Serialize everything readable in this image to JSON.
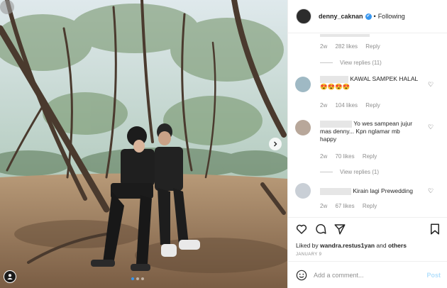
{
  "header": {
    "username": "denny_caknan",
    "verified_mark": "✔",
    "separator": "•",
    "follow_status": "Following",
    "more_icon": "more-horizontal-icon"
  },
  "comments": [
    {
      "text": "",
      "time": "2w",
      "likes": "282 likes",
      "reply": "Reply",
      "view_replies": "View replies (11)"
    },
    {
      "text": "KAWAL SAMPEK HALAL",
      "emoji": "😍😍😍😍",
      "time": "2w",
      "likes": "104 likes",
      "reply": "Reply"
    },
    {
      "text_line1": "Yo wes sampean jujur",
      "text_line2": "mas denny... Kpn nglamar mb",
      "text_line3": "happy",
      "time": "2w",
      "likes": "70 likes",
      "reply": "Reply",
      "view_replies": "View replies (1)"
    },
    {
      "text": "Kirain lagi Prewedding",
      "time": "2w",
      "likes": "67 likes",
      "reply": "Reply"
    }
  ],
  "actions": {
    "icons": [
      "heart-icon",
      "comment-icon",
      "share-icon",
      "bookmark-icon"
    ],
    "liked_by_prefix": "Liked by ",
    "liked_by_user": "wandra.restus1yan",
    "liked_by_and": " and ",
    "liked_by_others": "others",
    "date": "JANUARY 9"
  },
  "add_comment": {
    "placeholder": "Add a comment...",
    "post_label": "Post"
  },
  "colors": {
    "accent": "#3897f0",
    "muted": "#8e8e8e",
    "post_disabled": "#b2dffc",
    "text": "#262626"
  }
}
